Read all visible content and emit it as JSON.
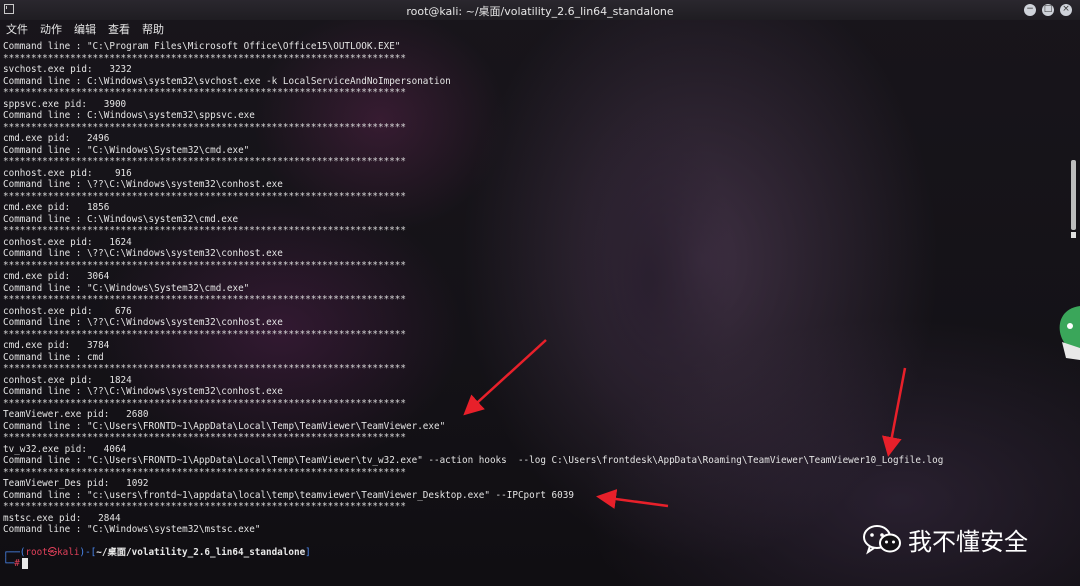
{
  "window": {
    "title": "root@kali: ~/桌面/volatility_2.6_lin64_standalone",
    "buttons": [
      "−",
      "□",
      "×"
    ]
  },
  "menu": [
    "文件",
    "动作",
    "编辑",
    "查看",
    "帮助"
  ],
  "terminal_lines": [
    "Command line : \"C:\\Program Files\\Microsoft Office\\Office15\\OUTLOOK.EXE\"",
    "************************************************************************",
    "svchost.exe pid:   3232",
    "Command line : C:\\Windows\\system32\\svchost.exe -k LocalServiceAndNoImpersonation",
    "************************************************************************",
    "sppsvc.exe pid:   3900",
    "Command line : C:\\Windows\\system32\\sppsvc.exe",
    "************************************************************************",
    "cmd.exe pid:   2496",
    "Command line : \"C:\\Windows\\System32\\cmd.exe\"",
    "************************************************************************",
    "conhost.exe pid:    916",
    "Command line : \\??\\C:\\Windows\\system32\\conhost.exe",
    "************************************************************************",
    "cmd.exe pid:   1856",
    "Command line : C:\\Windows\\system32\\cmd.exe",
    "************************************************************************",
    "conhost.exe pid:   1624",
    "Command line : \\??\\C:\\Windows\\system32\\conhost.exe",
    "************************************************************************",
    "cmd.exe pid:   3064",
    "Command line : \"C:\\Windows\\System32\\cmd.exe\"",
    "************************************************************************",
    "conhost.exe pid:    676",
    "Command line : \\??\\C:\\Windows\\system32\\conhost.exe",
    "************************************************************************",
    "cmd.exe pid:   3784",
    "Command line : cmd",
    "************************************************************************",
    "conhost.exe pid:   1824",
    "Command line : \\??\\C:\\Windows\\system32\\conhost.exe",
    "************************************************************************",
    "TeamViewer.exe pid:   2680",
    "Command line : \"C:\\Users\\FRONTD~1\\AppData\\Local\\Temp\\TeamViewer\\TeamViewer.exe\"",
    "************************************************************************",
    "tv_w32.exe pid:   4064",
    "Command line : \"C:\\Users\\FRONTD~1\\AppData\\Local\\Temp\\TeamViewer\\tv_w32.exe\" --action hooks  --log C:\\Users\\frontdesk\\AppData\\Roaming\\TeamViewer\\TeamViewer10_Logfile.log",
    "************************************************************************",
    "TeamViewer_Des pid:   1092",
    "Command line : \"c:\\users\\frontd~1\\appdata\\local\\temp\\teamviewer\\TeamViewer_Desktop.exe\" --IPCport 6039",
    "************************************************************************",
    "mstsc.exe pid:   2844",
    "Command line : \"C:\\Windows\\system32\\mstsc.exe\""
  ],
  "prompt": {
    "frame_open": "┌──(",
    "user_host": "root㉿kali",
    "frame_mid": ")-[",
    "path": "~/桌面/volatility_2.6_lin64_standalone",
    "frame_close": "]",
    "second_prefix": "└─",
    "symbol": "#"
  },
  "watermark": {
    "text": "我不懂安全",
    "icon": "wechat-icon"
  },
  "colors": {
    "arrow": "#e8202a",
    "prompt_frame": "#4c8bf5",
    "prompt_user": "#e0405a"
  }
}
